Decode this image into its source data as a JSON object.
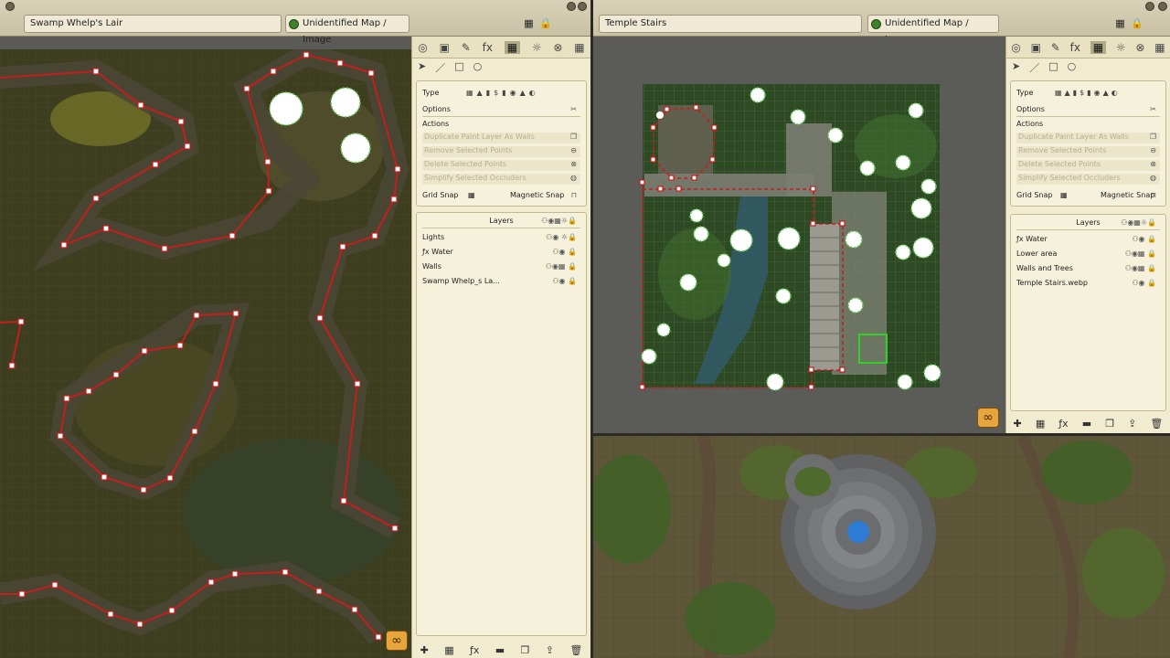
{
  "left_window": {
    "title": "Swamp Whelp's Lair",
    "map_label": "Unidentified Map / Image",
    "panel": {
      "tabs": [
        "◎",
        "▣",
        "✎",
        "fx",
        "▦",
        "☼",
        "⊗",
        "▦"
      ],
      "type_label": "Type",
      "options_label": "Options",
      "actions_label": "Actions",
      "actions": [
        "Duplicate Paint Layer As Walls",
        "Remove Selected Points",
        "Delete Selected Points",
        "Simplify Selected Occluders"
      ],
      "grid_snap": "Grid Snap",
      "magnetic_snap": "Magnetic Snap",
      "layers_label": "Layers",
      "layers": [
        "Lights",
        "Water",
        "Walls",
        "Swamp Whelp_s La..."
      ]
    }
  },
  "right_window": {
    "title": "Temple Stairs",
    "map_label": "Unidentified Map / Image",
    "panel": {
      "type_label": "Type",
      "options_label": "Options",
      "actions_label": "Actions",
      "actions": [
        "Duplicate Paint Layer As Walls",
        "Remove Selected Points",
        "Delete Selected Points",
        "Simplify Selected Occluders"
      ],
      "grid_snap": "Grid Snap",
      "magnetic_snap": "Magnetic Snap",
      "layers_label": "Layers",
      "layers": [
        "Water",
        "Lower area",
        "Walls and Trees",
        "Temple Stairs.webp"
      ]
    }
  },
  "colors": {
    "wall_line": "#c41e1e",
    "light_ring": "#59c44c",
    "panel_bg": "#f1ecd0"
  }
}
